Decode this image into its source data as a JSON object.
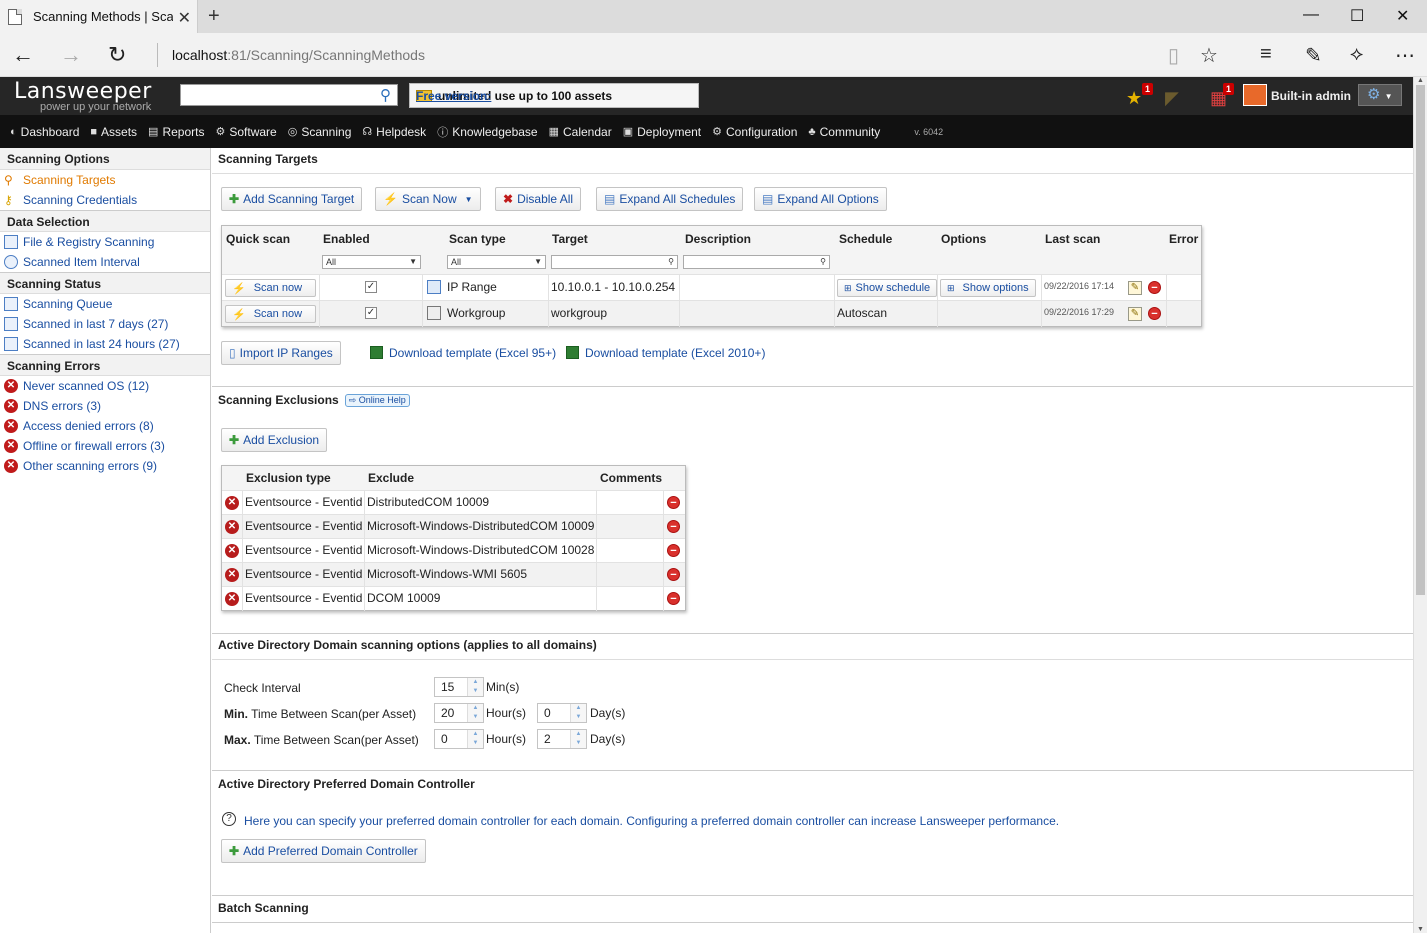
{
  "browser": {
    "tab_title": "Scanning Methods | Sca",
    "url_host": "localhost",
    "url_path": ":81/Scanning/ScanningMethods"
  },
  "header": {
    "logo": "Lansweeper",
    "tagline": "power up your network",
    "search_placeholder": "",
    "free_link": "Free version:",
    "free_text": "unlimited use up to 100 assets",
    "star_badge": "1",
    "calendar_badge": "1",
    "admin_name": "Built-in admin"
  },
  "menu": {
    "items": [
      {
        "label": "Dashboard",
        "icon": "◐"
      },
      {
        "label": "Assets",
        "icon": "■"
      },
      {
        "label": "Reports",
        "icon": "▤"
      },
      {
        "label": "Software",
        "icon": "⚙"
      },
      {
        "label": "Scanning",
        "icon": "◎"
      },
      {
        "label": "Helpdesk",
        "icon": "☊"
      },
      {
        "label": "Knowledgebase",
        "icon": "ⓘ"
      },
      {
        "label": "Calendar",
        "icon": "▦"
      },
      {
        "label": "Deployment",
        "icon": "▣"
      },
      {
        "label": "Configuration",
        "icon": "⚙"
      },
      {
        "label": "Community",
        "icon": "♣"
      }
    ],
    "version": "v. 6042"
  },
  "sidebar": {
    "sections": [
      {
        "title": "Scanning Options",
        "items": [
          {
            "label": "Scanning Targets",
            "icon": "magnifier-icon",
            "active": true
          },
          {
            "label": "Scanning Credentials",
            "icon": "key-icon"
          }
        ]
      },
      {
        "title": "Data Selection",
        "items": [
          {
            "label": "File & Registry Scanning",
            "icon": "document-icon"
          },
          {
            "label": "Scanned Item Interval",
            "icon": "clock-icon"
          }
        ]
      },
      {
        "title": "Scanning Status",
        "items": [
          {
            "label": "Scanning Queue",
            "icon": "queue-icon"
          },
          {
            "label": "Scanned in last 7 days (27)",
            "icon": "document-icon"
          },
          {
            "label": "Scanned in last 24 hours (27)",
            "icon": "document-icon"
          }
        ]
      },
      {
        "title": "Scanning Errors",
        "items": [
          {
            "label": "Never scanned OS (12)",
            "icon": "error-icon"
          },
          {
            "label": "DNS errors (3)",
            "icon": "error-icon"
          },
          {
            "label": "Access denied errors (8)",
            "icon": "error-icon"
          },
          {
            "label": "Offline or firewall errors (3)",
            "icon": "error-icon"
          },
          {
            "label": "Other scanning errors (9)",
            "icon": "error-icon"
          }
        ]
      }
    ]
  },
  "targets": {
    "title": "Scanning Targets",
    "buttons": {
      "add": "Add Scanning Target",
      "scan_now": "Scan Now",
      "disable_all": "Disable All",
      "expand_schedules": "Expand All Schedules",
      "expand_options": "Expand All Options"
    },
    "columns": [
      "Quick scan",
      "Enabled",
      "Scan type",
      "Target",
      "Description",
      "Schedule",
      "Options",
      "Last scan",
      "Error"
    ],
    "filter_all": "All",
    "rows": [
      {
        "quick": "Scan now",
        "enabled": "✓",
        "type": "IP Range",
        "target": "10.10.0.1 - 10.10.0.254",
        "schedule_btn": "Show schedule",
        "options_btn": "Show options",
        "last_scan": "09/22/2016 17:14"
      },
      {
        "quick": "Scan now",
        "enabled": "✓",
        "type": "Workgroup",
        "target": "workgroup",
        "schedule": "Autoscan",
        "last_scan": "09/22/2016 17:29"
      }
    ],
    "import_btn": "Import IP Ranges",
    "template_95": "Download template (Excel 95+)",
    "template_2010": "Download template (Excel 2010+)"
  },
  "exclusions": {
    "title": "Scanning Exclusions",
    "help": "Online Help",
    "add_btn": "Add Exclusion",
    "columns": [
      "Exclusion type",
      "Exclude",
      "Comments"
    ],
    "rows": [
      {
        "type": "Eventsource - Eventid",
        "exclude": "DistributedCOM 10009"
      },
      {
        "type": "Eventsource - Eventid",
        "exclude": "Microsoft-Windows-DistributedCOM 10009"
      },
      {
        "type": "Eventsource - Eventid",
        "exclude": "Microsoft-Windows-DistributedCOM 10028"
      },
      {
        "type": "Eventsource - Eventid",
        "exclude": "Microsoft-Windows-WMI 5605"
      },
      {
        "type": "Eventsource - Eventid",
        "exclude": "DCOM 10009"
      }
    ]
  },
  "ad_options": {
    "title": "Active Directory Domain scanning options (applies to all domains)",
    "check_interval_label": "Check Interval",
    "check_interval": "15",
    "check_interval_unit": "Min(s)",
    "min_prefix": "Min.",
    "min_label": "Time Between Scan(per Asset)",
    "min_hours": "20",
    "min_days": "0",
    "max_prefix": "Max.",
    "max_label": "Time Between Scan(per Asset)",
    "max_hours": "0",
    "max_days": "2",
    "hours_unit": "Hour(s)",
    "days_unit": "Day(s)"
  },
  "preferred_dc": {
    "title": "Active Directory Preferred Domain Controller",
    "info": "Here you can specify your preferred domain controller for each domain. Configuring a preferred domain controller can increase Lansweeper performance.",
    "add_btn": "Add Preferred Domain Controller"
  },
  "batch": {
    "title": "Batch Scanning"
  }
}
